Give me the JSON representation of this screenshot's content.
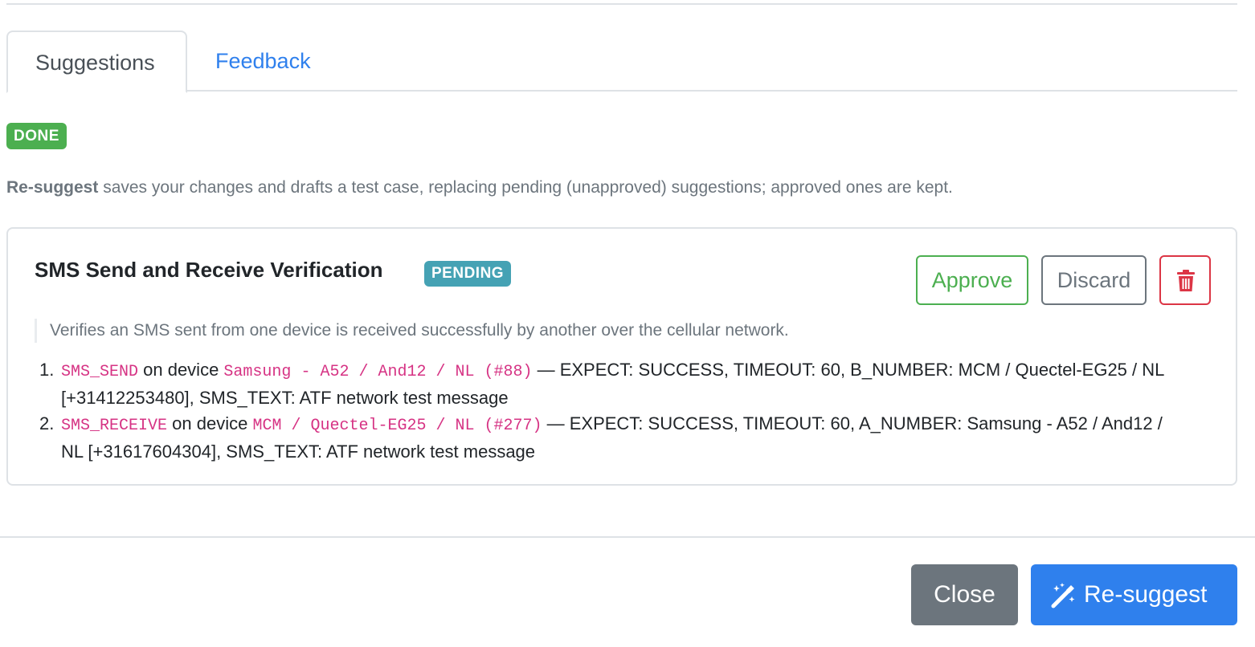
{
  "tabs": [
    {
      "label": "Suggestions",
      "active": true
    },
    {
      "label": "Feedback",
      "active": false
    }
  ],
  "status_badge": "DONE",
  "help": {
    "bold": "Re-suggest",
    "text": " saves your changes and drafts a test case, replacing pending (unapproved) suggestions; approved ones are kept."
  },
  "suggestion": {
    "title": "SMS Send and Receive Verification",
    "status": "PENDING",
    "approve_label": "Approve",
    "discard_label": "Discard",
    "delete_icon": "trash-icon",
    "description": "Verifies an SMS sent from one device is received successfully by another over the cellular network.",
    "steps": [
      {
        "num": "1.",
        "action": "SMS_SEND",
        "on_device": " on device ",
        "device": "Samsung - A52 / And12 / NL (#88)",
        "rest_line1": " — EXPECT: SUCCESS, TIMEOUT: 60, B_NUMBER: MCM / Quectel-EG25 / NL",
        "rest_line2": "[+31412253480], SMS_TEXT: ATF network test message"
      },
      {
        "num": "2.",
        "action": "SMS_RECEIVE",
        "on_device": " on device ",
        "device": "MCM / Quectel-EG25 / NL (#277)",
        "rest_line1": " — EXPECT: SUCCESS, TIMEOUT: 60, A_NUMBER: Samsung - A52 / And12 /",
        "rest_line2": "NL [+31617604304], SMS_TEXT: ATF network test message"
      }
    ]
  },
  "footer": {
    "close_label": "Close",
    "resuggest_label": "Re-suggest",
    "resuggest_icon": "magic-wand-icon"
  },
  "colors": {
    "primary": "#2f80ed",
    "success": "#4caf50",
    "info": "#45a2b4",
    "danger": "#dc3545",
    "secondary": "#6c757d",
    "code": "#d63384"
  }
}
